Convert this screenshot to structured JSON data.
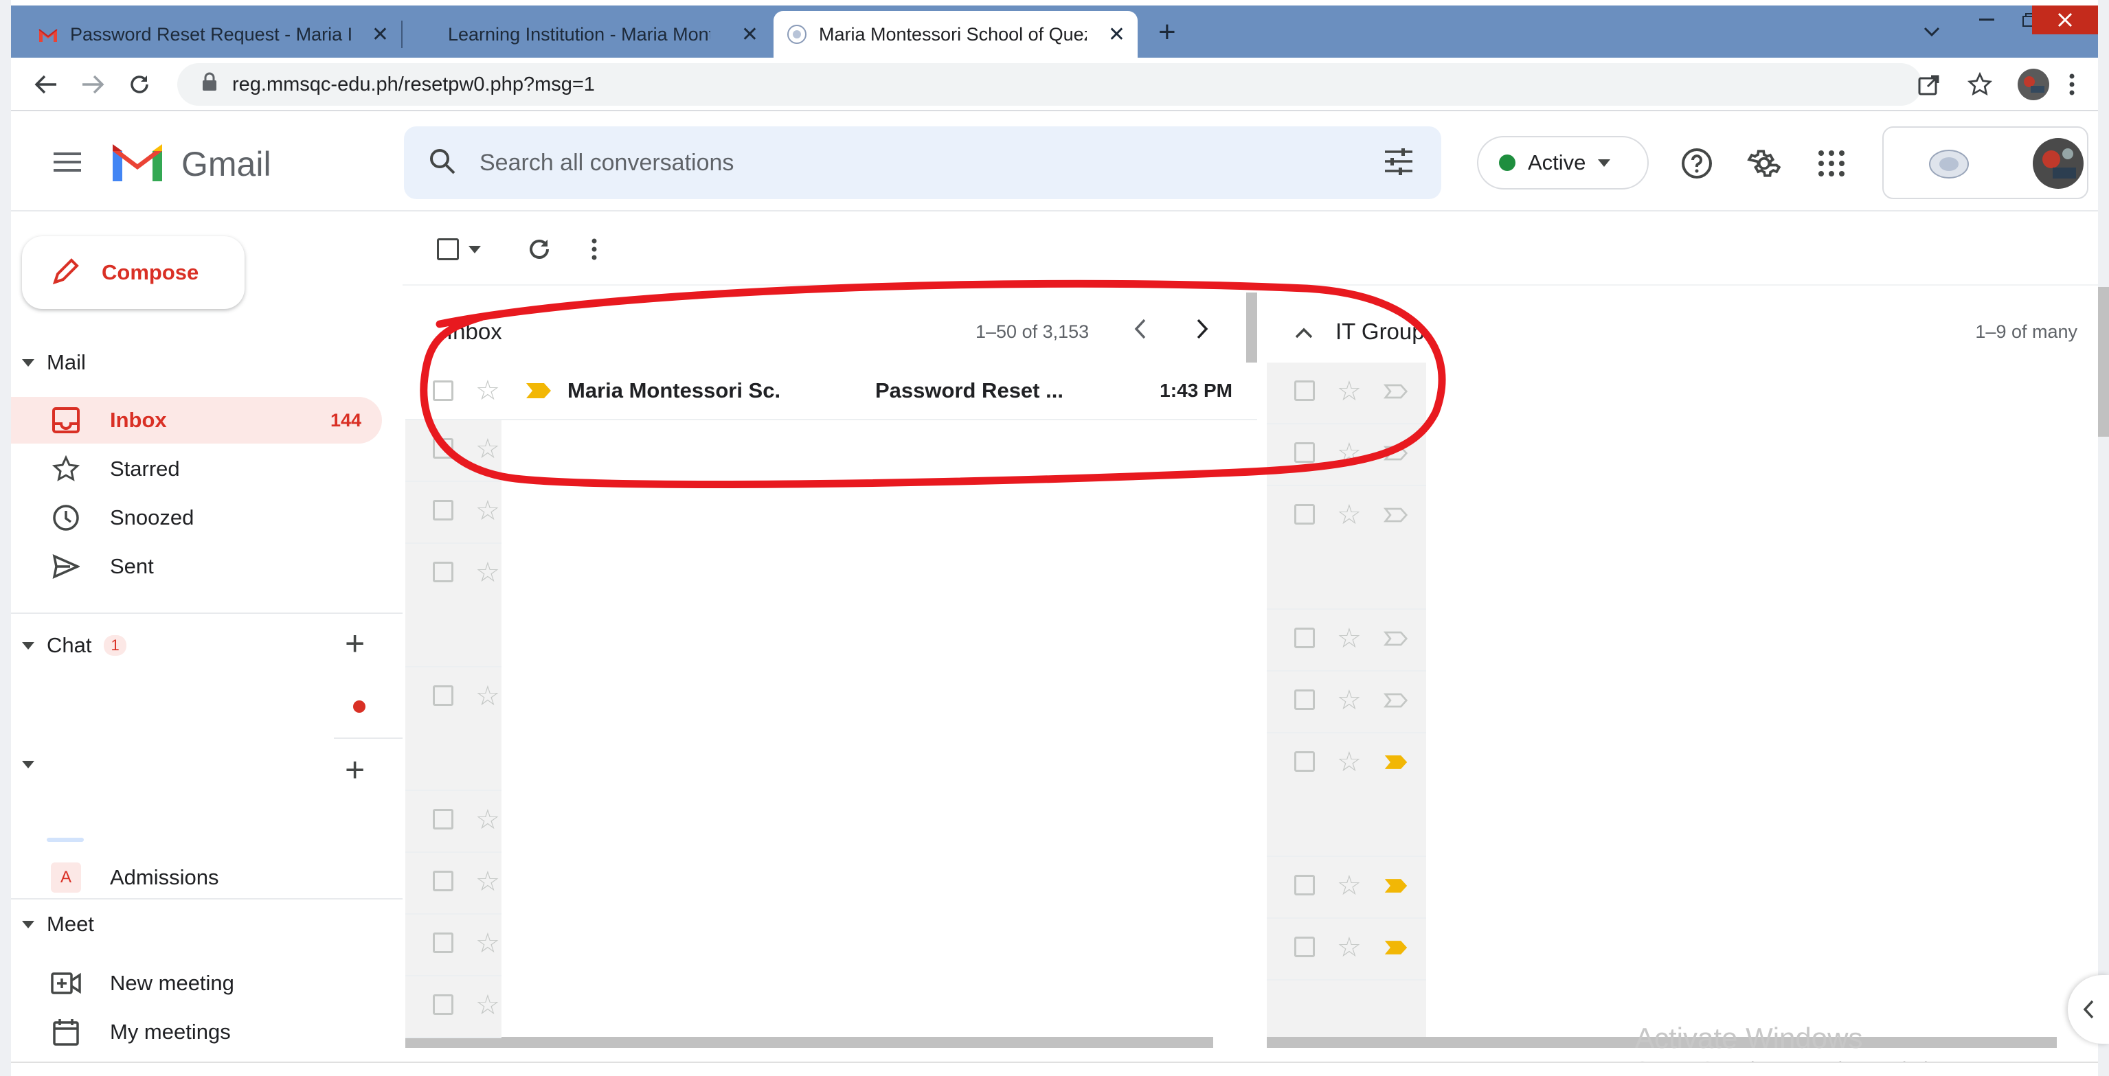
{
  "browser": {
    "tabs": [
      {
        "title": "Password Reset Request - Maria I",
        "close": "✕"
      },
      {
        "title": "Learning Institution - Maria Mont",
        "close": "✕"
      },
      {
        "title": "Maria Montessori School of Quez",
        "close": "✕"
      }
    ],
    "new_tab": "+",
    "url": "reg.mmsqc-edu.ph/resetpw0.php?msg=1"
  },
  "gmail": {
    "app_name": "Gmail",
    "search_placeholder": "Search all conversations",
    "status_label": "Active",
    "status_color": "#1e8e3e",
    "brand_red": "#d93025"
  },
  "sidebar": {
    "compose_label": "Compose",
    "mail_header": "Mail",
    "items": [
      {
        "label": "Inbox",
        "count": "144",
        "icon": "inbox-icon",
        "active": true
      },
      {
        "label": "Starred",
        "icon": "star-icon"
      },
      {
        "label": "Snoozed",
        "icon": "clock-icon"
      },
      {
        "label": "Sent",
        "icon": "send-icon"
      }
    ],
    "chat_header": "Chat",
    "chat_badge": "1",
    "spaces_item": "Admissions",
    "spaces_avatar": "A",
    "meet_header": "Meet",
    "meet_items": [
      {
        "label": "New meeting",
        "icon": "video-add-icon"
      },
      {
        "label": "My meetings",
        "icon": "calendar-icon"
      }
    ]
  },
  "inbox_pane": {
    "title": "Inbox",
    "range": "1–50 of 3,153",
    "first_row": {
      "sender": "Maria Montessori Sc.",
      "subject": "Password Reset ...",
      "time": "1:43 PM"
    }
  },
  "group_pane": {
    "title": "IT Group",
    "range": "1–9 of many"
  },
  "watermark": {
    "line1": "Activate Windows",
    "line2": "Go to PC settings to activate Windows."
  }
}
